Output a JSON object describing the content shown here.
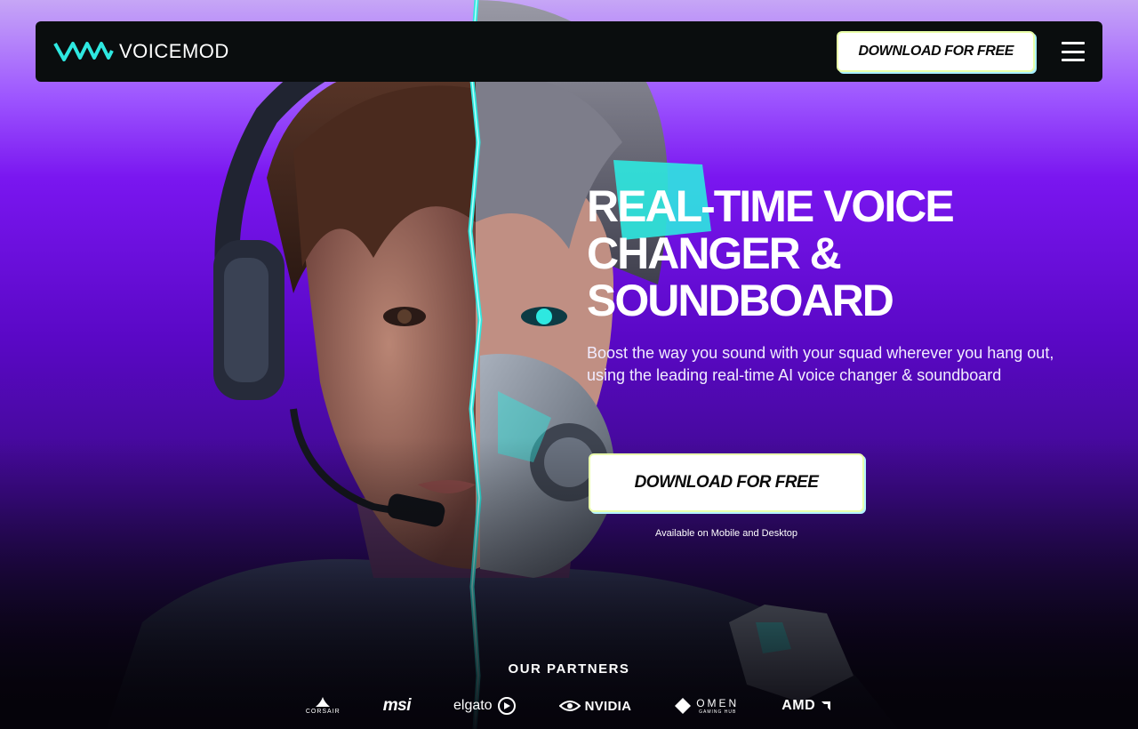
{
  "nav": {
    "logo_text": "VOICEMOD",
    "download_label": "DOWNLOAD FOR FREE",
    "menu_icon": "hamburger-menu-icon"
  },
  "hero": {
    "title": "REAL-TIME VOICE CHANGER & SOUNDBOARD",
    "subtitle": "Boost the way you sound with your squad wherever you hang out, using the leading real-time AI voice changer & soundboard",
    "cta_label": "DOWNLOAD FOR FREE",
    "cta_note": "Available on Mobile and Desktop"
  },
  "partners": {
    "title": "OUR PARTNERS",
    "items": [
      "CORSAIR",
      "msi",
      "elgato",
      "NVIDIA",
      "OMEN",
      "AMD"
    ],
    "omen_sub": "GAMING HUB"
  },
  "colors": {
    "accent_cyan": "#2ee8e0",
    "purple": "#7a16f0",
    "nav_bg": "#0a0d0e"
  }
}
